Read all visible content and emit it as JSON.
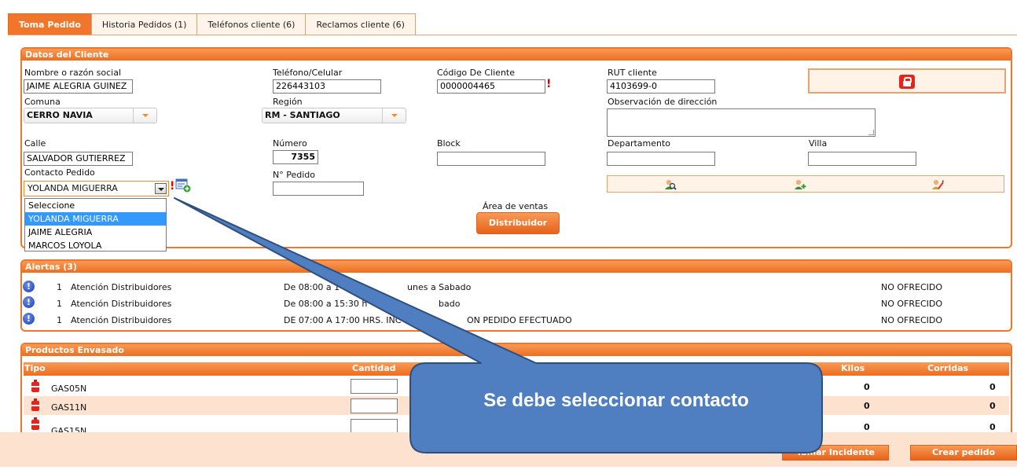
{
  "tabs": [
    {
      "label": "Toma Pedido",
      "active": true
    },
    {
      "label": "Historia Pedidos (1)",
      "active": false
    },
    {
      "label": "Teléfonos cliente (6)",
      "active": false
    },
    {
      "label": "Reclamos cliente (6)",
      "active": false
    }
  ],
  "cliente": {
    "title": "Datos del Cliente",
    "nombre_label": "Nombre o razón social",
    "nombre_value": "JAIME ALEGRIA GUINEZ",
    "telefono_label": "Teléfono/Celular",
    "telefono_value": "226443103",
    "codigo_label": "Código De Cliente",
    "codigo_value": "0000004465",
    "rut_label": "RUT cliente",
    "rut_value": "4103699-0",
    "comuna_label": "Comuna",
    "comuna_value": "CERRO NAVIA",
    "region_label": "Región",
    "region_value": "RM - SANTIAGO",
    "observacion_label": "Observación de dirección",
    "calle_label": "Calle",
    "calle_value": "SALVADOR GUTIERREZ",
    "numero_label": "Número",
    "numero_value": "7355",
    "block_label": "Block",
    "departamento_label": "Departamento",
    "villa_label": "Villa",
    "contacto_label": "Contacto Pedido",
    "contacto_value": "YOLANDA MIGUERRA",
    "npedido_label": "N° Pedido",
    "area_label": "Área de ventas",
    "area_button": "Distribuidor",
    "required_mark": "!",
    "contact_options": [
      "Seleccione",
      "YOLANDA MIGUERRA",
      "JAIME ALEGRIA",
      "MARCOS LOYOLA"
    ],
    "contact_selected_index": 1
  },
  "alertas": {
    "title": "Alertas (3)",
    "rows": [
      {
        "count": "1",
        "name": "Atención Distribuidores",
        "schedule": "De 08:00 a 1",
        "schedule_tail": "unes a Sabado",
        "status": "NO OFRECIDO"
      },
      {
        "count": "1",
        "name": "Atención Distribuidores",
        "schedule": "De 08:00 a 15:30 h",
        "schedule_tail": "bado",
        "status": "NO OFRECIDO"
      },
      {
        "count": "1",
        "name": "Atención Distribuidores",
        "schedule": "DE 07:00 A 17:00 HRS. INC",
        "schedule_tail": "ON PEDIDO EFECTUADO",
        "status": "NO OFRECIDO"
      }
    ]
  },
  "productos": {
    "title": "Productos Envasado",
    "col_tipo": "Tipo",
    "col_cantidad": "Cantidad",
    "col_kilos": "Kilos",
    "col_corridas": "Corridas",
    "rows": [
      {
        "tipo": "GAS05N",
        "kilos": "0",
        "corridas": "0"
      },
      {
        "tipo": "GAS11N",
        "kilos": "0",
        "corridas": "0"
      },
      {
        "tipo": "GAS15N",
        "kilos": "0",
        "corridas": "0"
      }
    ]
  },
  "footer": {
    "tomar_incidente": "Tomar Incidente",
    "crear_pedido": "Crear pedido"
  },
  "callout": {
    "text": "Se debe seleccionar contacto",
    "fill": "#4f7fc0",
    "border": "#2e4f7e"
  },
  "colors": {
    "accent": "#f1762b",
    "light_accent": "#fde3cf",
    "required": "#e00000",
    "highlight": "#3399ff"
  }
}
